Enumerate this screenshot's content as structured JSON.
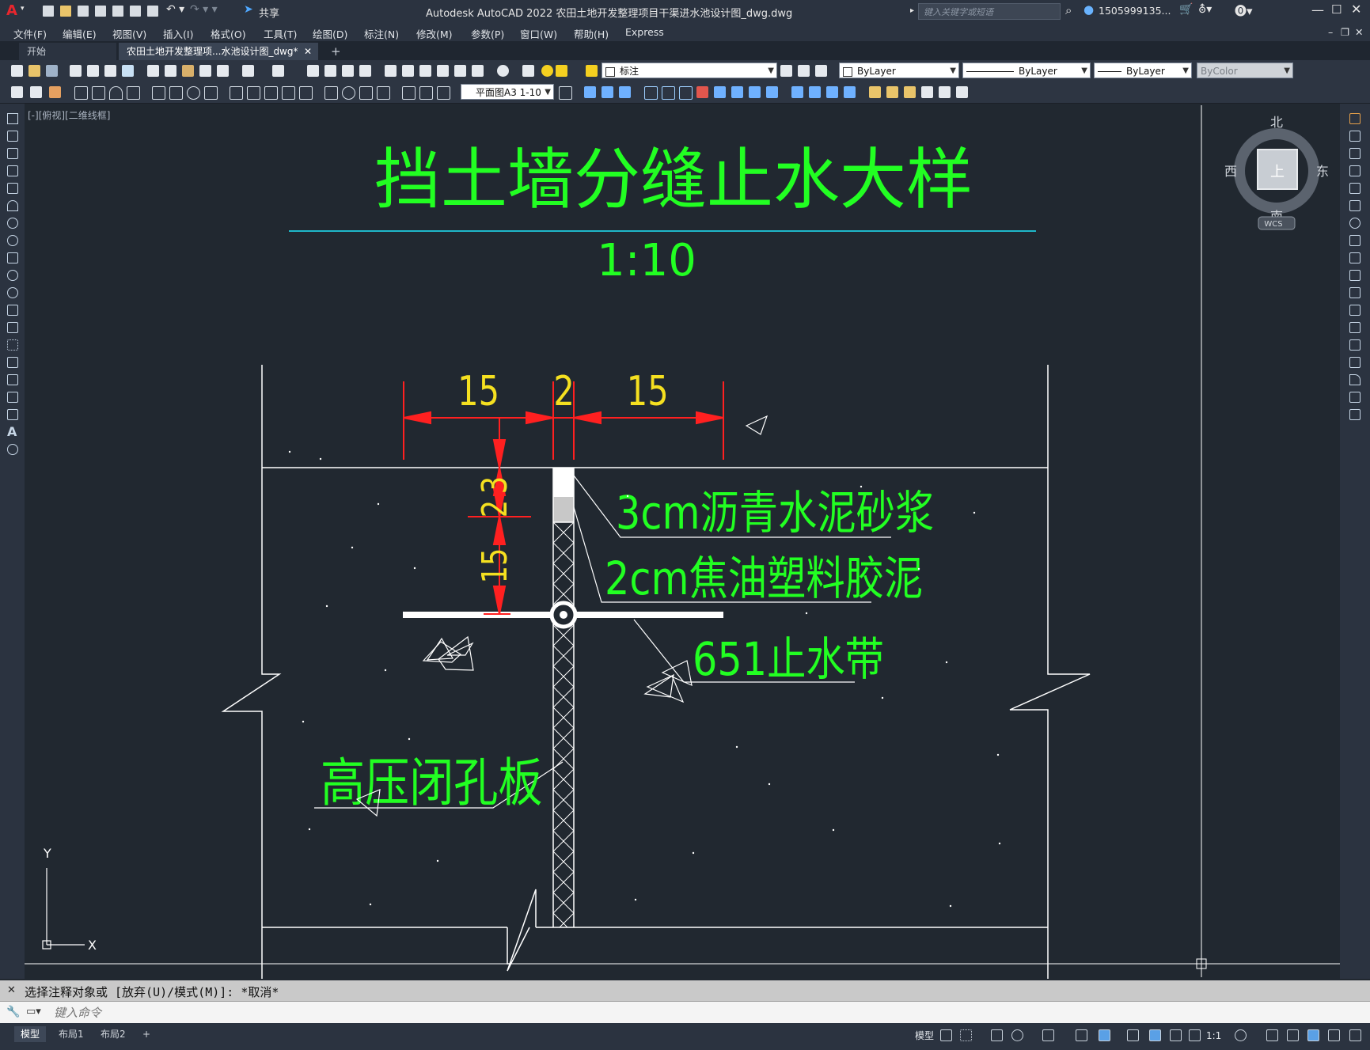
{
  "titlebar": {
    "app_letter": "A",
    "share": "共享",
    "title": "Autodesk AutoCAD 2022    农田土地开发整理项目干渠进水池设计图_dwg.dwg",
    "search_placeholder": "键入关键字或短语",
    "user": "1505999135..."
  },
  "menus": [
    "文件(F)",
    "编辑(E)",
    "视图(V)",
    "插入(I)",
    "格式(O)",
    "工具(T)",
    "绘图(D)",
    "标注(N)",
    "修改(M)",
    "参数(P)",
    "窗口(W)",
    "帮助(H)",
    "Express"
  ],
  "tabs": {
    "start": "开始",
    "active": "农田土地开发整理项...水池设计图_dwg*",
    "add": "+"
  },
  "toolbar": {
    "layer": "标注",
    "color": "ByLayer",
    "linetype": "ByLayer",
    "lineweight": "ByLayer",
    "plotstyle": "ByColor",
    "annoscale": "平面图A3 1-10"
  },
  "viewport": {
    "label": "[-][俯视][二维线框]"
  },
  "viewcube": {
    "north": "北",
    "south": "南",
    "east": "东",
    "west": "西",
    "top": "上",
    "wcs": "WCS"
  },
  "ucs": {
    "x": "X",
    "y": "Y"
  },
  "drawing": {
    "title": "挡土墙分缝止水大样",
    "scale": "1:10",
    "dims": {
      "left_width": "15",
      "gap": "2",
      "right_width": "15",
      "v1": "3",
      "v2": "2",
      "v3": "15"
    },
    "labels": {
      "mortar": "3cm沥青水泥砂浆",
      "tar": "2cm焦油塑料胶泥",
      "waterstop": "651止水带",
      "board": "高压闭孔板"
    },
    "colors": {
      "text": "#22ff22",
      "dim_text": "#f5e020",
      "dim_line": "#ff2020",
      "geometry": "#ffffff",
      "underline": "#1fb7c9"
    }
  },
  "command": {
    "history": "选择注释对象或 [放弃(U)/模式(M)]: *取消*",
    "placeholder": "键入命令"
  },
  "layouts": [
    "模型",
    "布局1",
    "布局2"
  ],
  "status": {
    "model": "模型",
    "scale": "1:1"
  }
}
